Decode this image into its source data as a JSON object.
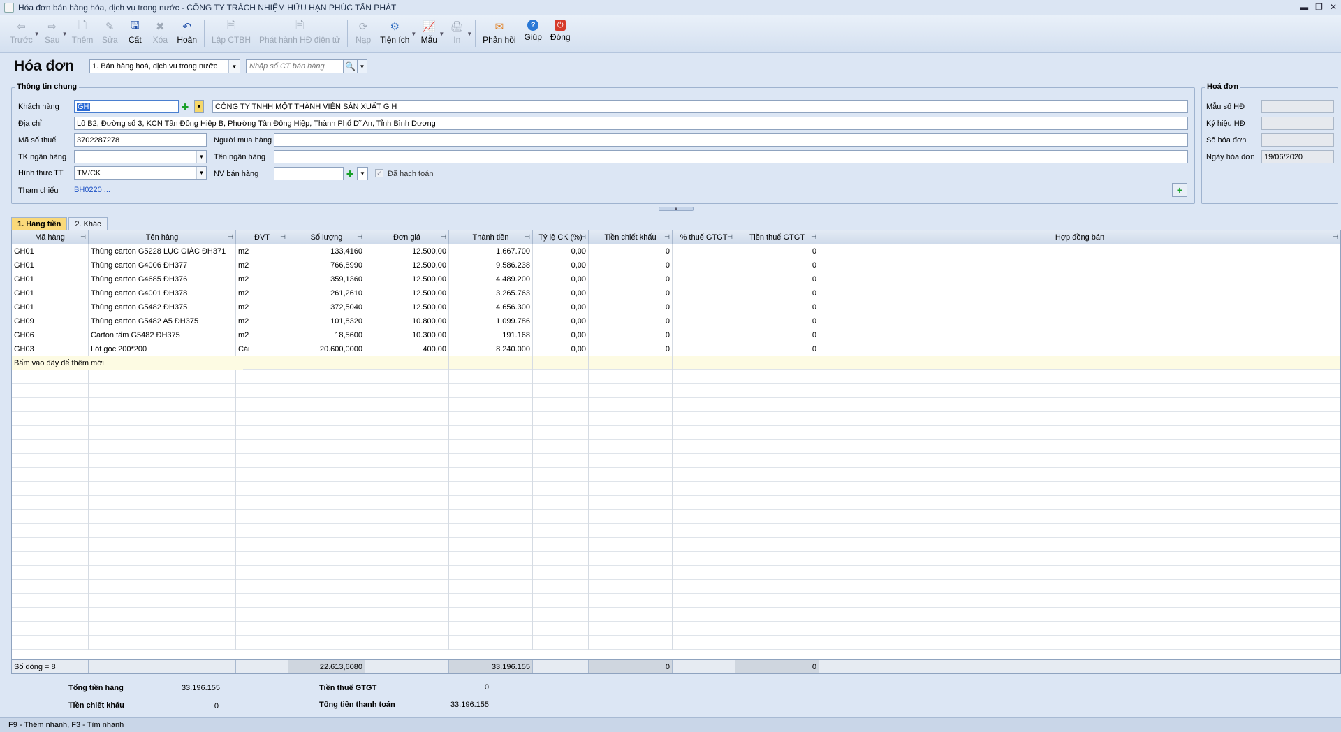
{
  "window": {
    "title": "Hóa đơn bán hàng hóa, dịch vụ trong nước - CÔNG TY TRÁCH NHIỆM HỮU HẠN PHÚC TẤN PHÁT",
    "controls": [
      "▬",
      "❐",
      "✕"
    ]
  },
  "toolbar": {
    "buttons": [
      {
        "label": "Trước",
        "icon": "arrow-left-icon",
        "enabled": false
      },
      {
        "label": "Sau",
        "icon": "arrow-right-icon",
        "enabled": false
      },
      {
        "label": "Thêm",
        "icon": "document-add-icon",
        "enabled": false
      },
      {
        "label": "Sửa",
        "icon": "edit-icon",
        "enabled": false
      },
      {
        "label": "Cất",
        "icon": "save-icon",
        "enabled": true
      },
      {
        "label": "Xóa",
        "icon": "delete-icon",
        "enabled": false
      },
      {
        "label": "Hoãn",
        "icon": "undo-icon",
        "enabled": true
      },
      {
        "label": "Lập CTBH",
        "icon": "document-icon",
        "enabled": false
      },
      {
        "label": "Phát hành HĐ điện tử",
        "icon": "e-invoice-icon",
        "enabled": false
      },
      {
        "label": "Nạp",
        "icon": "reload-icon",
        "enabled": false
      },
      {
        "label": "Tiện ích",
        "icon": "utility-icon",
        "enabled": true
      },
      {
        "label": "Mẫu",
        "icon": "template-icon",
        "enabled": true
      },
      {
        "label": "In",
        "icon": "print-icon",
        "enabled": false
      },
      {
        "label": "Phản hồi",
        "icon": "mail-icon",
        "enabled": true
      },
      {
        "label": "Giúp",
        "icon": "help-icon",
        "enabled": true
      },
      {
        "label": "Đóng",
        "icon": "close-icon",
        "enabled": true
      }
    ]
  },
  "header": {
    "title": "Hóa đơn",
    "invoice_type": "1. Bán hàng hoá, dịch vụ trong nước",
    "search_placeholder": "Nhập số CT bán hàng"
  },
  "general": {
    "group_title": "Thông tin chung",
    "customer_label": "Khách hàng",
    "customer_code": "GH",
    "customer_name": "CÔNG TY TNHH MỘT THÀNH VIÊN SẢN XUẤT G H",
    "address_label": "Địa chỉ",
    "address": "Lô B2, Đường số 3, KCN Tân Đông Hiệp B, Phường Tân Đông Hiệp, Thành Phố Dĩ An, Tỉnh Bình Dương",
    "tax_code_label": "Mã số thuế",
    "tax_code": "3702287278",
    "buyer_label": "Người mua hàng",
    "buyer": "",
    "bank_account_label": "TK ngân hàng",
    "bank_account": "",
    "bank_name_label": "Tên ngân hàng",
    "bank_name": "",
    "payment_method_label": "Hình thức TT",
    "payment_method": "TM/CK",
    "salesperson_label": "NV bán hàng",
    "salesperson": "",
    "accounted_label": "Đã hạch toán",
    "reference_label": "Tham chiếu",
    "reference_value": "BH0220 ..."
  },
  "invoice": {
    "group_title": "Hoá đơn",
    "template_label": "Mẫu số HĐ",
    "template": "",
    "symbol_label": "Ký hiệu HĐ",
    "symbol": "",
    "number_label": "Số hóa đơn",
    "number": "",
    "date_label": "Ngày hóa đơn",
    "date": "19/06/2020"
  },
  "tabs": [
    "1. Hàng tiền",
    "2. Khác"
  ],
  "grid": {
    "columns": [
      "Mã hàng",
      "Tên hàng",
      "ĐVT",
      "Số lượng",
      "Đơn giá",
      "Thành tiền",
      "Tỷ lệ CK (%)",
      "Tiền chiết khấu",
      "% thuế GTGT",
      "Tiền thuế GTGT",
      "Hợp đồng bán"
    ],
    "rows": [
      [
        "GH01",
        "Thùng carton G5228 LỤC GIÁC ĐH371",
        "m2",
        "133,4160",
        "12.500,00",
        "1.667.700",
        "0,00",
        "0",
        "",
        "0",
        ""
      ],
      [
        "GH01",
        "Thùng carton G4006 ĐH377",
        "m2",
        "766,8990",
        "12.500,00",
        "9.586.238",
        "0,00",
        "0",
        "",
        "0",
        ""
      ],
      [
        "GH01",
        "Thùng carton G4685 ĐH376",
        "m2",
        "359,1360",
        "12.500,00",
        "4.489.200",
        "0,00",
        "0",
        "",
        "0",
        ""
      ],
      [
        "GH01",
        "Thùng carton G4001 ĐH378",
        "m2",
        "261,2610",
        "12.500,00",
        "3.265.763",
        "0,00",
        "0",
        "",
        "0",
        ""
      ],
      [
        "GH01",
        "Thùng carton G5482 ĐH375",
        "m2",
        "372,5040",
        "12.500,00",
        "4.656.300",
        "0,00",
        "0",
        "",
        "0",
        ""
      ],
      [
        "GH09",
        "Thùng carton G5482 A5 ĐH375",
        "m2",
        "101,8320",
        "10.800,00",
        "1.099.786",
        "0,00",
        "0",
        "",
        "0",
        ""
      ],
      [
        "GH06",
        "Carton tấm G5482 ĐH375",
        "m2",
        "18,5600",
        "10.300,00",
        "191.168",
        "0,00",
        "0",
        "",
        "0",
        ""
      ],
      [
        "GH03",
        "Lót góc 200*200",
        "Cái",
        "20.600,0000",
        "400,00",
        "8.240.000",
        "0,00",
        "0",
        "",
        "0",
        ""
      ]
    ],
    "new_row_text": "Bấm vào đây để thêm mới",
    "footer": {
      "row_count": "Số dòng = 8",
      "total_quantity": "22.613,6080",
      "total_amount": "33.196.155",
      "total_discount": "0",
      "total_vat": "0"
    }
  },
  "totals": {
    "goods_total_label": "Tổng tiền hàng",
    "goods_total": "33.196.155",
    "discount_label": "Tiền chiết khấu",
    "discount": "0",
    "vat_label": "Tiền thuế GTGT",
    "vat": "0",
    "payment_total_label": "Tổng tiền thanh toán",
    "payment_total": "33.196.155"
  },
  "status": "F9 - Thêm nhanh, F3 - Tìm nhanh"
}
